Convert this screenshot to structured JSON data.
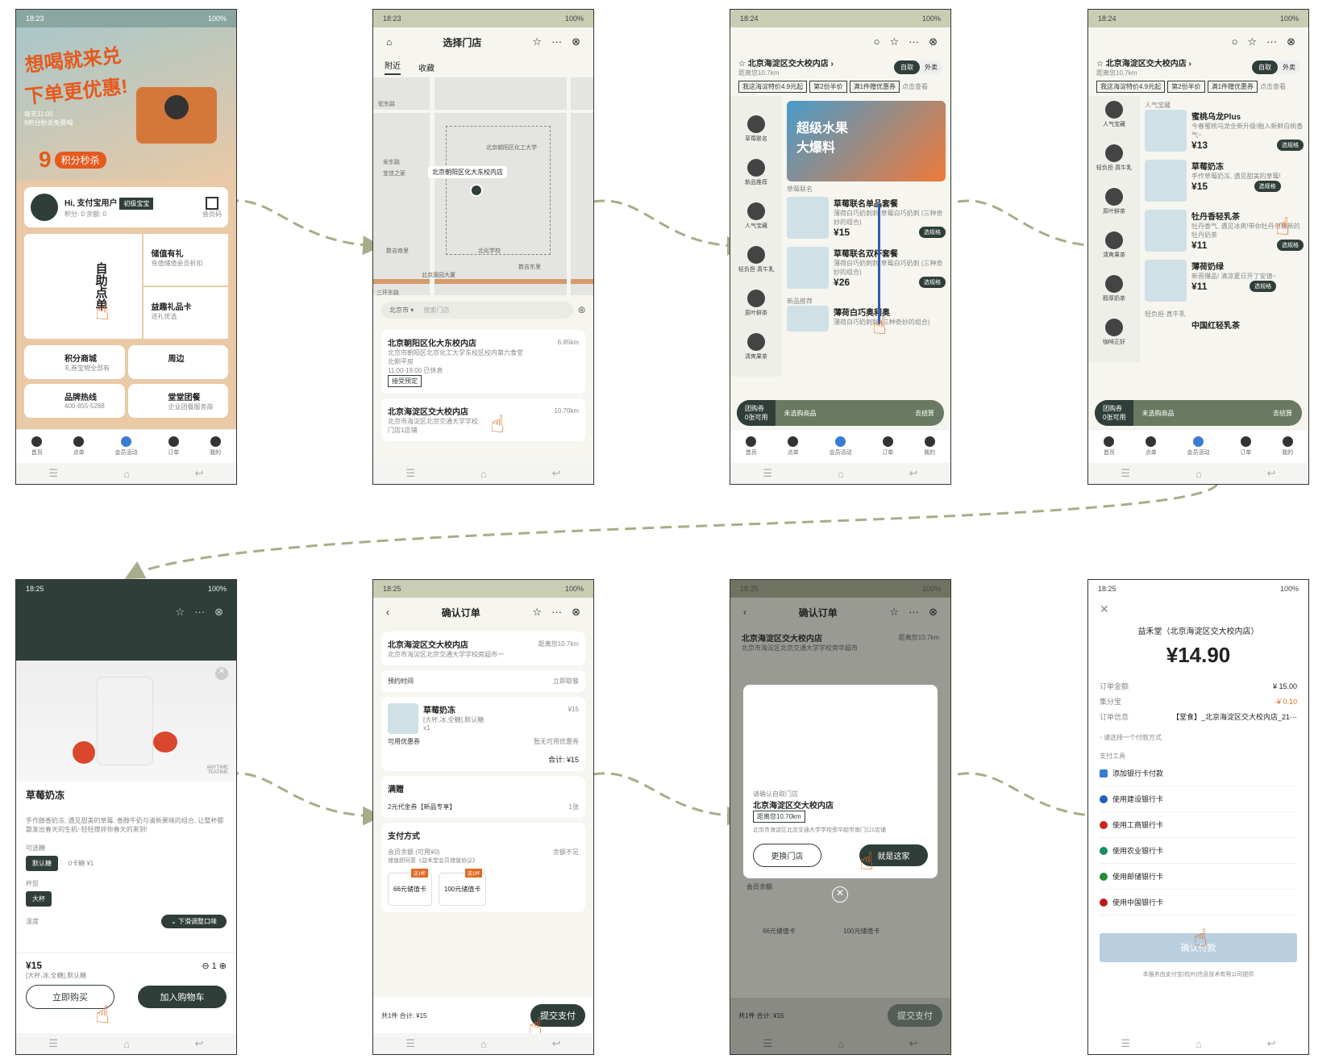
{
  "p1": {
    "time": "18:23",
    "battery": "100%",
    "h1": "想喝就来兑",
    "h2": "下单更优惠!",
    "note1": "每天11:00",
    "note2": "9积分秒杀免费喝",
    "badge9": "9",
    "badge_txt": "积分秒杀",
    "user": "Hi, 支付宝用户",
    "lvl": "初级宝宝",
    "pts": "积分: 0    余额: 0",
    "code": "会员码",
    "self": "自助点单",
    "stored": "储值有礼",
    "stored_sub": "充值储值会员折扣",
    "gift": "益趣礼品卡",
    "gift_sub": "送礼优选",
    "mall": "积分商城",
    "mall_sub": "礼券宝物全部有",
    "week": "周边",
    "hot": "品牌热线",
    "hot_num": "400-855-5288",
    "grp": "堂堂团餐",
    "grp_sub": "企业团餐服务商",
    "tabs": [
      "首页",
      "点单",
      "会员活动",
      "订单",
      "我的"
    ]
  },
  "p2": {
    "time": "18:23",
    "title": "选择门店",
    "tabs": [
      "附近",
      "收藏"
    ],
    "map_label": "北京朝阳区化大东校内店",
    "map_places": [
      "驼东路",
      "安东路",
      "宜佳之家",
      "北京朝阳区化工大学",
      "北化学校",
      "东三环路",
      "北京化工校区",
      "首都新村",
      "三环东路",
      "数吉南里",
      "数吉东里",
      "北京唐园大厦"
    ],
    "city": "北京市",
    "search": "搜索门店",
    "s1_name": "北京朝阳区化大东校内店",
    "s1_dist": "6.85km",
    "s1_addr": "北京市朝阳区北京化工大学东校区校内第六食堂北侧平房",
    "s1_hours": "11:00-19:00",
    "s1_status": "已休息",
    "s1_tag": "接受预定",
    "s2_name": "北京海淀区交大校内店",
    "s2_dist": "10.70km",
    "s2_addr": "北京市海淀区北京交通大学学校",
    "s2_addr2": "门店1店铺"
  },
  "p3": {
    "time": "18:24",
    "store": "北京海淀区交大校内店",
    "dist": "距离您10.7km",
    "pick": "自取",
    "deliv": "外卖",
    "promos": [
      "我这海淀特价4.9元起",
      "第2份半价",
      "满1件赠优惠券"
    ],
    "more": "点击查看",
    "cats": [
      "草莓联名",
      "新品推荐",
      "人气宝藏",
      "轻负担·真牛乳",
      "原叶鲜茶",
      "清爽果茶"
    ],
    "banner1": "超级水果",
    "banner2": "大爆料",
    "sec": "草莓联名",
    "prod1": "草莓联名单品套餐",
    "prod1_d": "薄荷白巧奶刺刺·草莓白巧奶刺 (三种奇妙的组合) ",
    "prod1_p": "15",
    "prod2": "草莓联名双杯套餐",
    "prod2_d": "薄荷白巧奶刺刺·草莓白巧奶刺 (三种奇妙的组合)",
    "prod2_p": "26",
    "sec2": "新品推荐",
    "prod3": "薄荷白巧奥利奥",
    "prod3_d": "薄荷白巧奶刺刺 (三种奇妙的组合)",
    "sel": "选规格",
    "coupon": "团购券",
    "coupon_sub": "0张可用",
    "cart": "未选购商品",
    "checkout": "去结算",
    "tabs": [
      "首页",
      "点单",
      "会员活动",
      "订单",
      "我的"
    ]
  },
  "p4": {
    "time": "18:24",
    "store": "北京海淀区交大校内店",
    "dist": "距离您10.7km",
    "pick": "自取",
    "deliv": "外卖",
    "promos": [
      "我这海淀特价4.9元起",
      "第2份半价",
      "满1件赠优惠券"
    ],
    "more": "点击查看",
    "cats": [
      "人气宝藏",
      "轻负担·真牛乳",
      "原叶鲜茶",
      "清爽果茶",
      "醇厚奶茶",
      "咖啡正好"
    ],
    "sec": "人气宝藏",
    "items": [
      {
        "n": "蜜桃乌龙Plus",
        "d": "今春蜜桃乌龙全新升级!融入新鲜白桃香气~",
        "p": "13"
      },
      {
        "n": "草莓奶冻",
        "d": "手作草莓奶冻, 遇见甜美的草莓!",
        "p": "15"
      },
      {
        "n": "牡丹香轻乳茶",
        "d": "牡丹香气, 遇见冰爽!带你牡丹与清新的牡丹奶茶",
        "p": "11"
      },
      {
        "n": "薄荷奶绿",
        "d": "新晋爆品! 清凉夏日开了安镇~",
        "p": "11"
      }
    ],
    "sec2": "轻负担·真牛乳",
    "prod5": "中国红轻乳茶",
    "sel": "选规格",
    "coupon": "团购券",
    "coupon_sub": "0张可用",
    "cart": "未选购商品",
    "checkout": "去结算",
    "tabs": [
      "首页",
      "点单",
      "会员活动",
      "订单",
      "我的"
    ]
  },
  "p5": {
    "time": "18:25",
    "name": "草莓奶冻",
    "desc": "手作醇香奶冻, 遇见甜美的草莓, 香醇牛奶与清新果味的组合, 让整杯都散发出春天的生机~轻轻搅拌你春天的来到!",
    "watermark": "ANYTIME TEATIME",
    "sugar": "可选糖",
    "s_opts": [
      "默认糖",
      "0卡糖 ¥1"
    ],
    "size": "杯型",
    "size_v": "大杯",
    "temp": "温度",
    "slide": "下滑调整口味",
    "price": "¥15",
    "spec": "[大杯,冰,全糖],默认糖",
    "qty": "1",
    "buy": "立即购买",
    "add": "加入购物车"
  },
  "p6": {
    "time": "18:25",
    "title": "确认订单",
    "store": "北京海淀区交大校内店",
    "addr": "北京市海淀区北京交通大学学校旁超市一",
    "dist": "距离您10.7km",
    "time_l": "预约时间",
    "time_v": "立即取餐",
    "item": "草莓奶冻",
    "spec": "[大杯,冰,全糖],默认糖",
    "qty": "x1",
    "price": "¥15",
    "coupon": "可用优惠券",
    "coupon_v": "暂无可用优惠券",
    "total": "合计: ¥15",
    "deal": "满赠",
    "deal_item": "2元代金券【新品专享】",
    "deal_n": "1张",
    "pay": "支付方式",
    "bal": "会员余额",
    "bal_sub": "(可用¥0)",
    "bal_note": "储值即同意《益禾堂会员储值协议》",
    "bal_v": "余额不足",
    "card1": "66元储值卡",
    "card2": "100元储值卡",
    "badge": "送1杯",
    "foot": "共1件  合计: ¥15",
    "submit": "提交支付"
  },
  "p7": {
    "time": "18:25",
    "title": "确认订单",
    "store": "北京海淀区交大校内店",
    "addr": "北京市海淀区北京交通大学学校旁华超市",
    "dist": "距离您10.7km",
    "conf": "请确认自取门店",
    "conf_store": "北京海淀区交大校内店",
    "conf_dist": "距离您10.70km",
    "conf_addr": "北京市海淀区北京交通大学学校旁华超市南门口1店铺",
    "change": "更换门店",
    "ok": "就是这家",
    "bal": "会员余额",
    "card1": "66元储值卡",
    "card2": "100元储值卡",
    "foot": "共1件  合计: ¥15",
    "submit": "提交支付"
  },
  "p8": {
    "time": "18:25",
    "merchant": "益禾堂（北京海淀区交大校内店）",
    "amount": "¥14.90",
    "l1": "订单金额",
    "v1": "¥ 15.00",
    "l2": "集分宝",
    "v2": "-¥ 0.10",
    "l3": "订单信息",
    "v3": "【堂食】_北京海淀区交大校内店_21···",
    "choose": "请选择一个付款方式",
    "tools": "支付工具",
    "banks": [
      "添加银行卡付款",
      "使用建设银行卡",
      "使用工商银行卡",
      "使用农业银行卡",
      "使用邮储银行卡",
      "使用中国银行卡"
    ],
    "confirm": "确认付款",
    "footer": "本服务由支付宝(杭州)信息技术有限公司提供"
  },
  "colors": {
    "brand": "#2f3e38",
    "accent": "#e06a22",
    "poster": "#e9c9a6"
  }
}
